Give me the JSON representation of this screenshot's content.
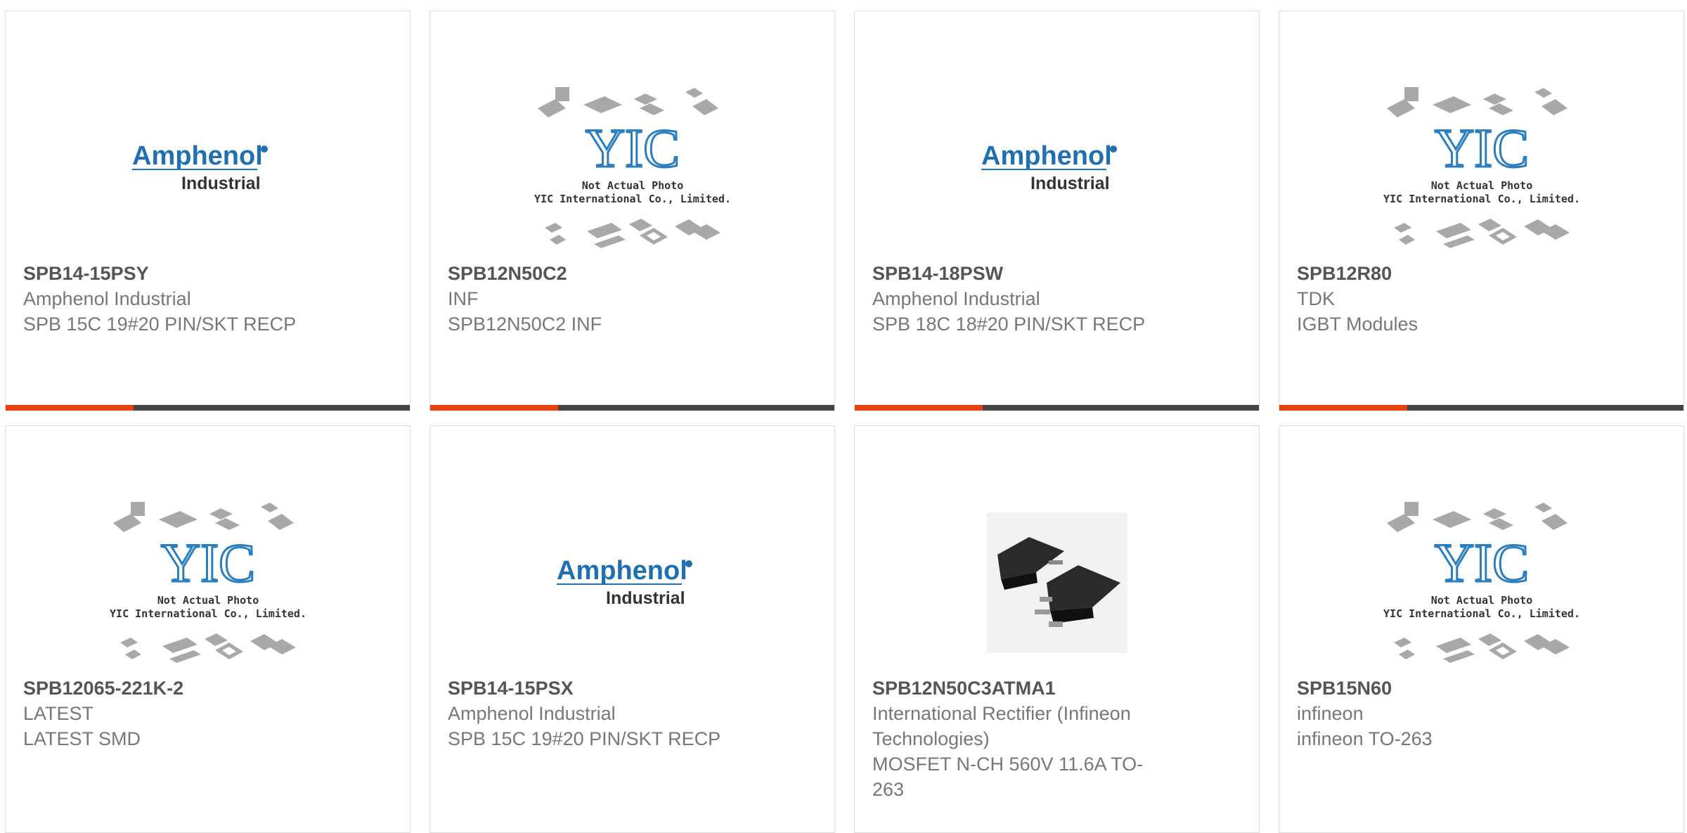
{
  "colors": {
    "accent": "#e8420e",
    "bar": "#444444",
    "logo_blue": "#1f6fb2"
  },
  "placeholder": {
    "line1": "Not Actual Photo",
    "line2": "YIC International Co., Limited.",
    "logo": "YIC"
  },
  "amphenol_logo": {
    "brand": "Amphenol",
    "sub": "Industrial"
  },
  "products": [
    {
      "part": "SPB14-15PSY",
      "maker": "Amphenol Industrial",
      "desc": [
        "SPB 15C 19#20 PIN/SKT RECP"
      ],
      "image": "amphenol-logo"
    },
    {
      "part": "SPB12N50C2",
      "maker": "INF",
      "desc": [
        "SPB12N50C2 INF"
      ],
      "image": "yic-placeholder"
    },
    {
      "part": "SPB14-18PSW",
      "maker": "Amphenol Industrial",
      "desc": [
        "SPB 18C 18#20 PIN/SKT RECP"
      ],
      "image": "amphenol-logo"
    },
    {
      "part": "SPB12R80",
      "maker": "TDK",
      "desc": [
        "IGBT Modules"
      ],
      "image": "yic-placeholder"
    },
    {
      "part": "SPB12065-221K-2",
      "maker": "LATEST",
      "desc": [
        "LATEST SMD"
      ],
      "image": "yic-placeholder"
    },
    {
      "part": "SPB14-15PSX",
      "maker": "Amphenol Industrial",
      "desc": [
        "SPB 15C 19#20 PIN/SKT RECP"
      ],
      "image": "amphenol-logo"
    },
    {
      "part": "SPB12N50C3ATMA1",
      "maker": "International Rectifier (Infineon Technologies)",
      "desc": [
        "MOSFET N-CH 560V 11.6A TO-263"
      ],
      "image": "to263-photo"
    },
    {
      "part": "SPB15N60",
      "maker": "infineon",
      "desc": [
        "infineon TO-263"
      ],
      "image": "yic-placeholder"
    }
  ]
}
